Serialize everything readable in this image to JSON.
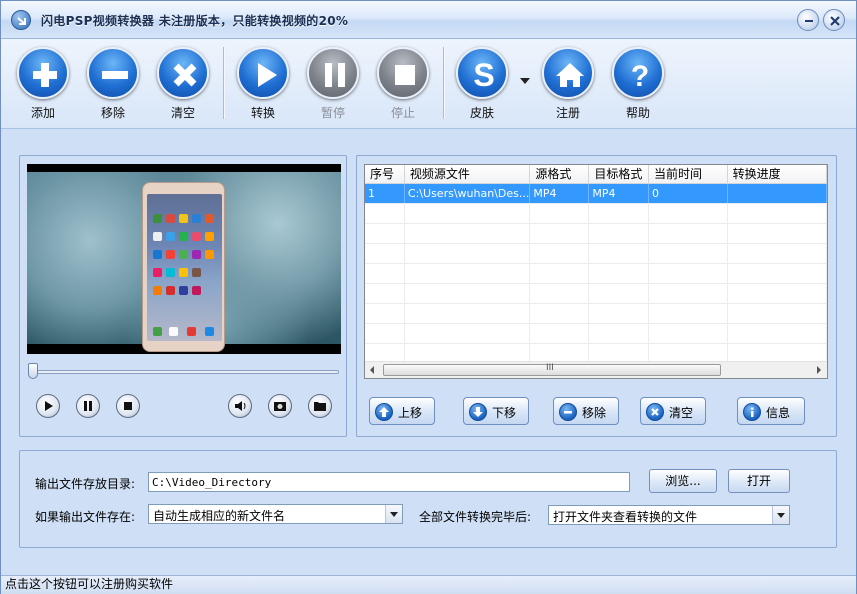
{
  "window": {
    "title": "闪电PSP视频转换器   未注册版本，只能转换视频的20%",
    "minimize_icon": "minimize-icon",
    "close_icon": "close-icon"
  },
  "toolbar": {
    "add": {
      "label": "添加",
      "icon": "plus-icon"
    },
    "remove": {
      "label": "移除",
      "icon": "minus-icon"
    },
    "clear": {
      "label": "清空",
      "icon": "x-icon"
    },
    "convert": {
      "label": "转换",
      "icon": "play-icon"
    },
    "pause": {
      "label": "暂停",
      "icon": "pause-icon",
      "disabled": true
    },
    "stop": {
      "label": "停止",
      "icon": "stop-icon",
      "disabled": true
    },
    "skin": {
      "label": "皮肤",
      "icon": "skin-s-icon"
    },
    "register": {
      "label": "注册",
      "icon": "home-icon"
    },
    "help": {
      "label": "帮助",
      "icon": "question-icon"
    }
  },
  "player": {
    "progress": 0,
    "controls": [
      "play-icon",
      "pause-icon",
      "stop-icon",
      "volume-icon",
      "snapshot-icon",
      "folder-icon"
    ]
  },
  "file_list": {
    "columns": [
      "序号",
      "视频源文件",
      "源格式",
      "目标格式",
      "当前时间",
      "转换进度"
    ],
    "rows": [
      {
        "index": "1",
        "source": "C:\\Users\\wuhan\\Des...",
        "src_format": "MP4",
        "dst_format": "MP4",
        "current_time": "0",
        "progress": ""
      }
    ],
    "scroll_grip": "III"
  },
  "list_actions": {
    "up": "上移",
    "down": "下移",
    "remove": "移除",
    "clear": "清空",
    "info": "信息"
  },
  "output": {
    "dir_label": "输出文件存放目录:",
    "dir_value": "C:\\Video_Directory",
    "browse_label": "浏览...",
    "open_label": "打开",
    "exists_label": "如果输出文件存在:",
    "exists_value": "自动生成相应的新文件名",
    "after_label": "全部文件转换完毕后:",
    "after_value": "打开文件夹查看转换的文件"
  },
  "status": {
    "text": "点击这个按钮可以注册购买软件"
  },
  "colors": {
    "accent": "#1f6fd3",
    "selection": "#3399ff",
    "window_bg": "#cfe0f6"
  }
}
